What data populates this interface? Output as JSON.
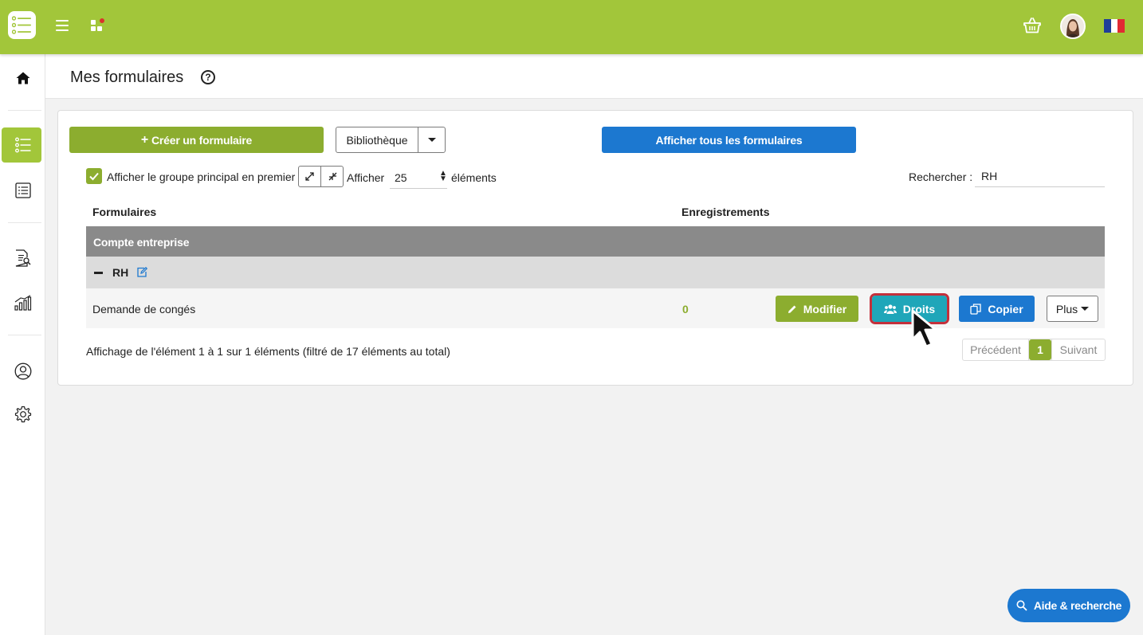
{
  "colors": {
    "brand_green": "#a2c63a",
    "button_green": "#8cad2f",
    "button_blue": "#1c78d0",
    "droits_teal": "#1fa6b9",
    "highlight_red": "#c4303b"
  },
  "topbar": {
    "logo": "app-logo-icon",
    "menu_icon": "hamburger-icon",
    "apps_icon": "apps-grid-icon",
    "cart_icon": "basket-icon",
    "avatar": "user-avatar",
    "language": "french-flag-icon"
  },
  "sidebar": {
    "items": [
      {
        "icon": "home-icon",
        "active": false
      },
      {
        "icon": "form-list-icon",
        "active": true
      },
      {
        "icon": "list-icon",
        "active": false
      },
      {
        "icon": "report-search-icon",
        "active": false
      },
      {
        "icon": "stats-chart-icon",
        "active": false
      },
      {
        "icon": "user-circle-icon",
        "active": false
      },
      {
        "icon": "gear-icon",
        "active": false
      }
    ]
  },
  "page": {
    "title": "Mes formulaires",
    "help_icon": "?"
  },
  "toolbar": {
    "create_label": "Créer un formulaire",
    "create_prefix": "+",
    "library_label": "Bibliothèque",
    "show_all_label": "Afficher tous les formulaires"
  },
  "filters": {
    "group_first_label": "Afficher le groupe principal en premier",
    "group_first_checked": true,
    "show_label": "Afficher",
    "page_length": "25",
    "elements_label": "éléments",
    "search_label": "Rechercher :",
    "search_value": "RH"
  },
  "table": {
    "headers": {
      "forms": "Formulaires",
      "records": "Enregistrements"
    },
    "group": "Compte entreprise",
    "subgroup": "RH",
    "rows": [
      {
        "name": "Demande de congés",
        "count": "0"
      }
    ],
    "actions": {
      "modify": "Modifier",
      "rights": "Droits",
      "copy": "Copier",
      "more": "Plus"
    }
  },
  "footer": {
    "info": "Affichage de l'élément 1 à 1 sur 1 éléments (filtré de 17 éléments au total)",
    "prev": "Précédent",
    "current": "1",
    "next": "Suivant"
  },
  "help_button": {
    "label": "Aide & recherche"
  }
}
